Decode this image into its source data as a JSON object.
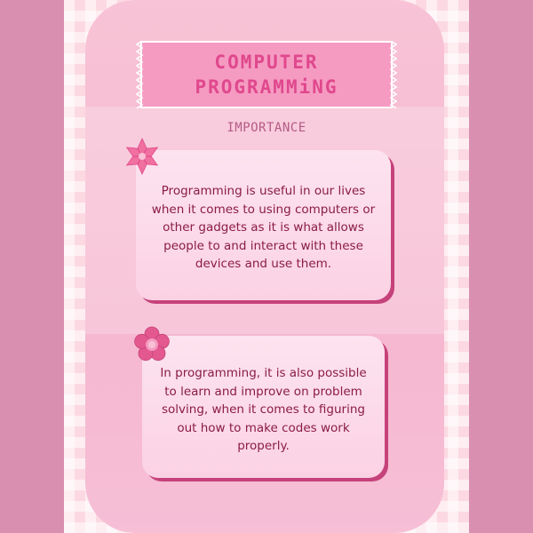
{
  "title": {
    "line1": "COMPUTER",
    "line2": "PROGRAMMiNG"
  },
  "subtitle": "IMPORTANCE",
  "cards": [
    {
      "text": "Programming is useful in our lives when it comes to using computers or other gadgets as it is what allows people to and interact with these devices and use them."
    },
    {
      "text": "In programming, it is also possible to learn and improve on problem solving, when it comes to figuring out how to make codes work properly."
    }
  ],
  "colors": {
    "background": "#d98fb0",
    "card": "#f8c3d6",
    "banner": "#f59bc2",
    "title_text": "#e0488d",
    "body_text": "#8a1c45",
    "shadow": "#c5427a"
  },
  "icons": [
    "flower-icon",
    "flower-icon"
  ]
}
